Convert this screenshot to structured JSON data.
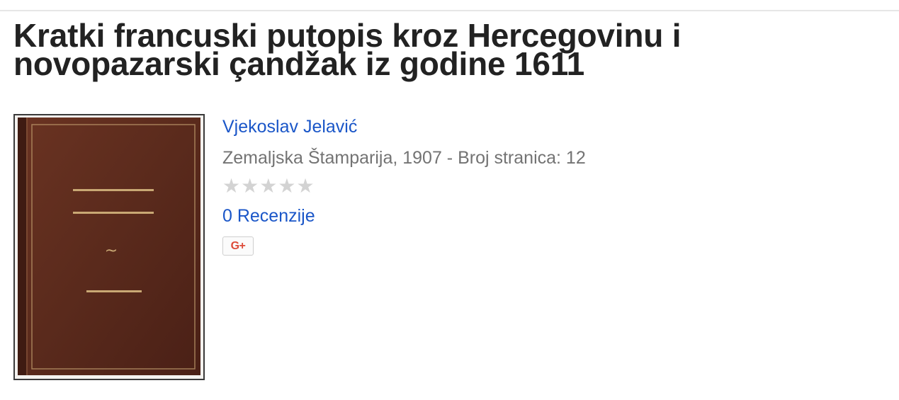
{
  "book": {
    "title": "Kratki francuski putopis kroz Hercegovinu i novopazarski çandžak iz godine 1611",
    "author": "Vjekoslav Jelavić",
    "publisher_line": "Zemaljska Štamparija, 1907 - Broj stranica: 12",
    "rating": 0,
    "rating_max": 5,
    "reviews_label": "0 Recenzije"
  },
  "cover": {
    "ornament": "~"
  },
  "share": {
    "gplus_label": "G+",
    "gplus_icon": "google-plus-icon"
  },
  "colors": {
    "link": "#1a56c8",
    "title": "#222222",
    "meta": "#737373",
    "cover_leather": "#5a2a1c",
    "cover_gold": "#c9a874",
    "star_empty": "#d3d3d3",
    "gplus_red": "#dd4b39"
  }
}
